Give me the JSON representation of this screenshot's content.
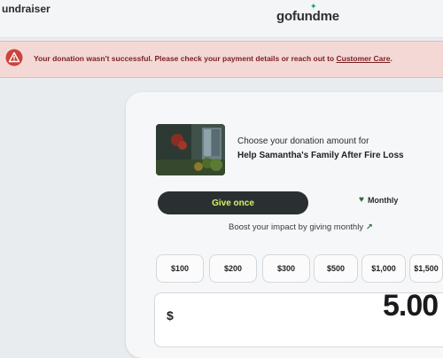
{
  "header": {
    "fundraiser_link": "undraiser",
    "logo": "gofundme"
  },
  "alert": {
    "icon": "warning-icon",
    "message": "Your donation wasn't successful. Please check your payment details or reach out to ",
    "link_text": "Customer Care",
    "suffix": ".",
    "colors": {
      "background": "#f3d8d6",
      "text": "#7a1f1f"
    }
  },
  "campaign": {
    "prompt": "Choose your donation amount for",
    "title": "Help Samantha's Family After Fire Loss"
  },
  "frequency": {
    "give_once": "Give once",
    "monthly": "Monthly",
    "selected": "Give once",
    "colors": {
      "active_bg": "#2a3031",
      "active_text": "#d9f16a"
    }
  },
  "boost": {
    "text": "Boost your impact by giving monthly",
    "arrow": "↗"
  },
  "amounts": [
    "$100",
    "$200",
    "$300",
    "$500",
    "$1,000",
    "$1,500"
  ],
  "custom_amount": {
    "currency": "$",
    "value": "5.00"
  }
}
